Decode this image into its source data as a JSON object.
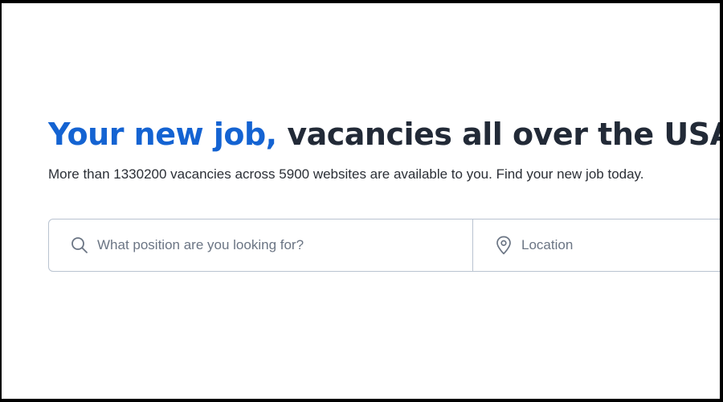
{
  "hero": {
    "headline_accent": "Your new job,",
    "headline_rest": " vacancies all over the USA",
    "subtitle": "More than 1330200 vacancies across 5900 websites are available to you. Find your new job today."
  },
  "search": {
    "position_placeholder": "What position are you looking for?",
    "position_value": "",
    "location_placeholder": "Location",
    "location_value": "",
    "search_icon": "search-icon",
    "location_icon": "location-pin-icon"
  },
  "colors": {
    "accent": "#1463d2",
    "heading": "#222a37",
    "border": "#b9c3d0",
    "placeholder": "#6b7584"
  }
}
